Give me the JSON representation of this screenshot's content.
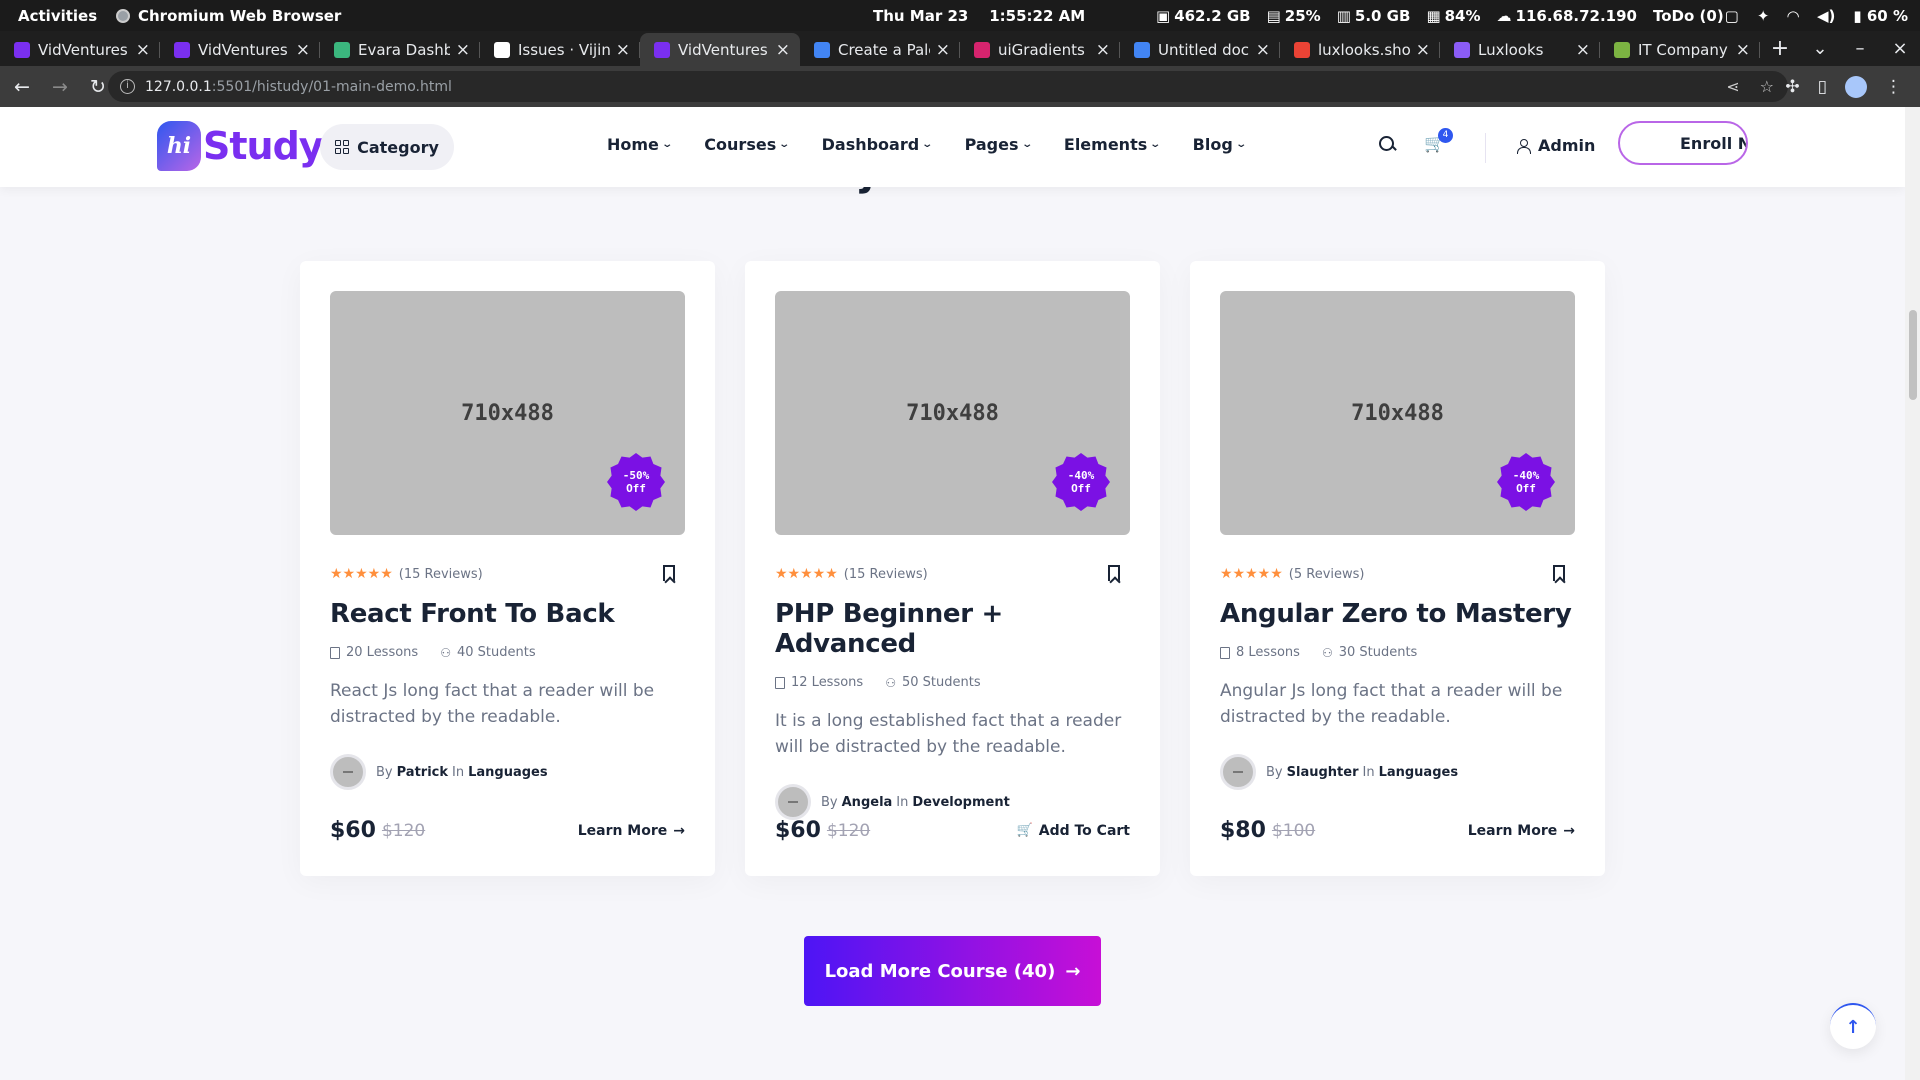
{
  "os": {
    "activities": "Activities",
    "app_name": "Chromium Web Browser",
    "clock": "Thu Mar 23    1:55:22 AM",
    "disk": "462.2 GB",
    "cpu": "25%",
    "mem": "5.0 GB",
    "swap": "84%",
    "ip": "116.68.72.190",
    "todo": "ToDo (0)",
    "battery": "60 %"
  },
  "tabs": [
    {
      "title": "VidVentures",
      "color": "#7a2ff0"
    },
    {
      "title": "VidVentures",
      "color": "#7a2ff0"
    },
    {
      "title": "Evara Dashbo",
      "color": "#3bb77e"
    },
    {
      "title": "Issues · VijinV",
      "color": "#ffffff"
    },
    {
      "title": "VidVentures",
      "color": "#7a2ff0",
      "active": true
    },
    {
      "title": "Create a Palet",
      "color": "#4285f4"
    },
    {
      "title": "uiGradients - ",
      "color": "#d6246e"
    },
    {
      "title": "Untitled docu",
      "color": "#4285f4"
    },
    {
      "title": "luxlooks.shop",
      "color": "#ea4335"
    },
    {
      "title": "Luxlooks",
      "color": "#8b5cf6"
    },
    {
      "title": "IT Company N",
      "color": "#7cb342"
    }
  ],
  "browser": {
    "url_host": "127.0.0.1",
    "url_path": ":5501/histudy/01-main-demo.html"
  },
  "header": {
    "logo_mark": "hi",
    "logo_word": "Study",
    "category_label": "Category",
    "menu": [
      "Home",
      "Courses",
      "Dashboard",
      "Pages",
      "Elements",
      "Blog"
    ],
    "cart_count": "4",
    "admin_label": "Admin",
    "enroll_label": "Enroll Now"
  },
  "section_title_fragment": "can join with us.",
  "courses": [
    {
      "image_placeholder": "710x488",
      "discount_pct": "-50%",
      "discount_word": "Off",
      "stars": "★★★★★",
      "reviews": "(15 Reviews)",
      "title": "React Front To Back",
      "lessons": "20 Lessons",
      "students": "40 Students",
      "description": "React Js long fact that a reader will be distracted by the readable.",
      "by": "By",
      "author": "Patrick",
      "in": "In",
      "category": "Languages",
      "price": "$60",
      "old_price": "$120",
      "action": "Learn More",
      "action_icon": "→"
    },
    {
      "image_placeholder": "710x488",
      "discount_pct": "-40%",
      "discount_word": "Off",
      "stars": "★★★★★",
      "reviews": "(15 Reviews)",
      "title": "PHP Beginner + Advanced",
      "lessons": "12 Lessons",
      "students": "50 Students",
      "description": "It is a long established fact that a reader will be distracted by the readable.",
      "by": "By",
      "author": "Angela",
      "in": "In",
      "category": "Development",
      "price": "$60",
      "old_price": "$120",
      "action": "Add To Cart",
      "action_icon": "🛒"
    },
    {
      "image_placeholder": "710x488",
      "discount_pct": "-40%",
      "discount_word": "Off",
      "stars": "★★★★★",
      "reviews": "(5 Reviews)",
      "title": "Angular Zero to Mastery",
      "lessons": "8 Lessons",
      "students": "30 Students",
      "description": "Angular Js long fact that a reader will be distracted by the readable.",
      "by": "By",
      "author": "Slaughter",
      "in": "In",
      "category": "Languages",
      "price": "$80",
      "old_price": "$100",
      "action": "Learn More",
      "action_icon": "→"
    }
  ],
  "load_more_label": "Load More Course (40)",
  "load_more_icon": "→",
  "back_to_top_icon": "↑"
}
